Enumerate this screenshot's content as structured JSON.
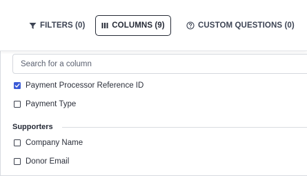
{
  "toolbar": {
    "filters_label": "FILTERS (0)",
    "columns_label": "COLUMNS (9)",
    "custom_questions_label": "CUSTOM QUESTIONS (0)"
  },
  "search": {
    "placeholder": "Search for a column"
  },
  "columns": {
    "items": [
      {
        "label": "Payment Processor Reference ID",
        "checked": true
      },
      {
        "label": "Payment Type",
        "checked": false
      }
    ]
  },
  "supporters": {
    "title": "Supporters",
    "items": [
      {
        "label": "Company Name",
        "checked": false
      },
      {
        "label": "Donor Email",
        "checked": false
      }
    ]
  },
  "colors": {
    "accent": "#3b5bd6",
    "active_border": "#252a36"
  }
}
